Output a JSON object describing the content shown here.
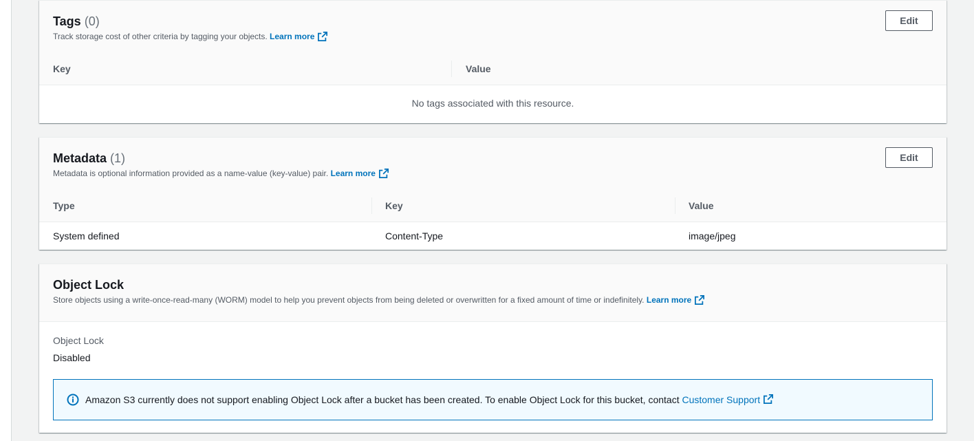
{
  "tags": {
    "title": "Tags",
    "count": "(0)",
    "description": "Track storage cost of other criteria by tagging your objects.",
    "learn_more": "Learn more",
    "edit_label": "Edit",
    "columns": [
      "Key",
      "Value"
    ],
    "empty_message": "No tags associated with this resource."
  },
  "metadata": {
    "title": "Metadata",
    "count": "(1)",
    "description": "Metadata is optional information provided as a name-value (key-value) pair.",
    "learn_more": "Learn more",
    "edit_label": "Edit",
    "columns": [
      "Type",
      "Key",
      "Value"
    ],
    "rows": [
      {
        "type": "System defined",
        "key": "Content-Type",
        "value": "image/jpeg"
      }
    ]
  },
  "object_lock": {
    "title": "Object Lock",
    "description": "Store objects using a write-once-read-many (WORM) model to help you prevent objects from being deleted or overwritten for a fixed amount of time or indefinitely.",
    "learn_more": "Learn more",
    "field_label": "Object Lock",
    "field_value": "Disabled",
    "alert_text": "Amazon S3 currently does not support enabling Object Lock after a bucket has been created. To enable Object Lock for this bucket, contact",
    "alert_link": "Customer Support"
  },
  "icons": {
    "external": "external-link-icon",
    "info": "info-icon"
  },
  "colors": {
    "link": "#0073bb",
    "background": "#f2f3f3",
    "alert_bg": "#f1faff"
  }
}
